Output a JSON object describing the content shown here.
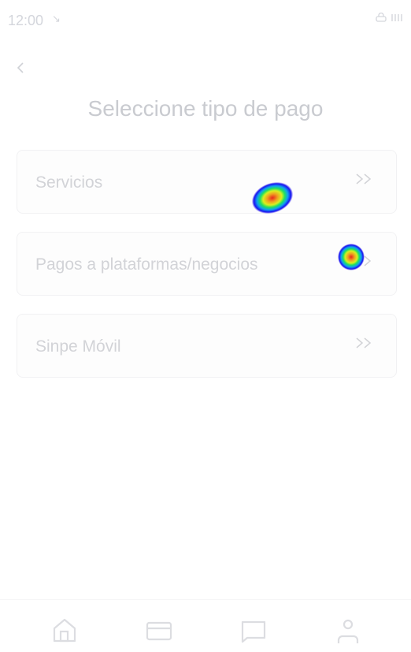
{
  "status_bar": {
    "time": "12:00",
    "arrow_icon": "↘",
    "right_icons": "lock-icon signal-icon"
  },
  "header": {
    "back_icon": "chevron-left-icon",
    "title": "Seleccione tipo de pago"
  },
  "options": [
    {
      "label": "Servicios",
      "chevron": "»"
    },
    {
      "label": "Pagos a plataformas/negocios",
      "chevron": "»"
    },
    {
      "label": "Sinpe Móvil",
      "chevron": "»"
    }
  ],
  "bottom_nav": [
    "home-icon",
    "card-icon",
    "chat-icon",
    "user-icon"
  ],
  "colors": {
    "text": "#d2d3d7",
    "icon": "#dcdde1"
  }
}
